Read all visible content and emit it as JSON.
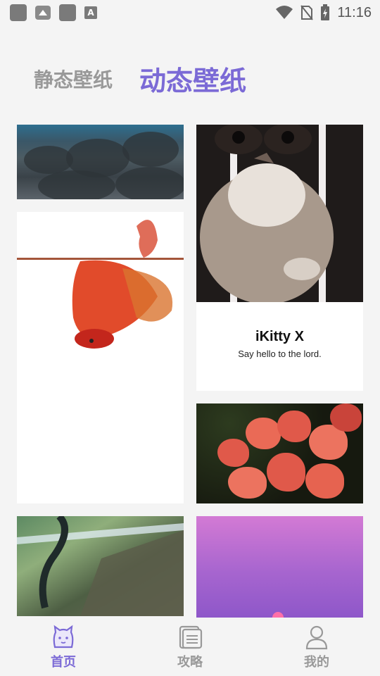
{
  "status_bar": {
    "time": "11:16",
    "icons": [
      "app-icon",
      "image-icon",
      "app-icon",
      "a-icon",
      "wifi-icon",
      "no-sim-icon",
      "battery-charging-icon"
    ]
  },
  "tabs": {
    "static_label": "静态壁纸",
    "dynamic_label": "动态壁纸",
    "active": "dynamic"
  },
  "cards": {
    "cat": {
      "title": "iKitty X",
      "subtitle": "Say hello to the lord."
    }
  },
  "bottom_nav": {
    "items": [
      {
        "label": "首页",
        "icon": "cat-face-icon",
        "active": true
      },
      {
        "label": "攻略",
        "icon": "document-icon",
        "active": false
      },
      {
        "label": "我的",
        "icon": "person-icon",
        "active": false
      }
    ]
  },
  "colors": {
    "accent": "#7b6ad6",
    "inactive": "#999999",
    "background": "#f4f4f4"
  }
}
